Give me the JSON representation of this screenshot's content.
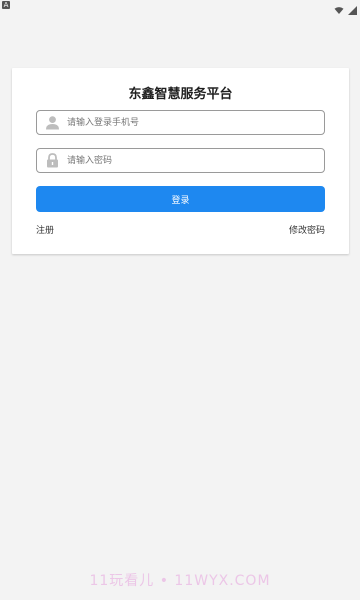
{
  "status_bar": {
    "left_badge": "A",
    "wifi_icon": "wifi-icon",
    "signal_icon": "signal-icon"
  },
  "login": {
    "title": "东鑫智慧服务平台",
    "phone": {
      "placeholder": "请输入登录手机号",
      "value": "",
      "icon": "user-icon"
    },
    "password": {
      "placeholder": "请输入密码",
      "value": "",
      "icon": "lock-icon"
    },
    "login_button": "登录",
    "register_link": "注册",
    "change_password_link": "修改密码"
  },
  "watermark": "11玩看儿 • 11WYX.COM",
  "colors": {
    "primary": "#1e88f0",
    "background": "#f3f3f3",
    "card": "#ffffff"
  }
}
